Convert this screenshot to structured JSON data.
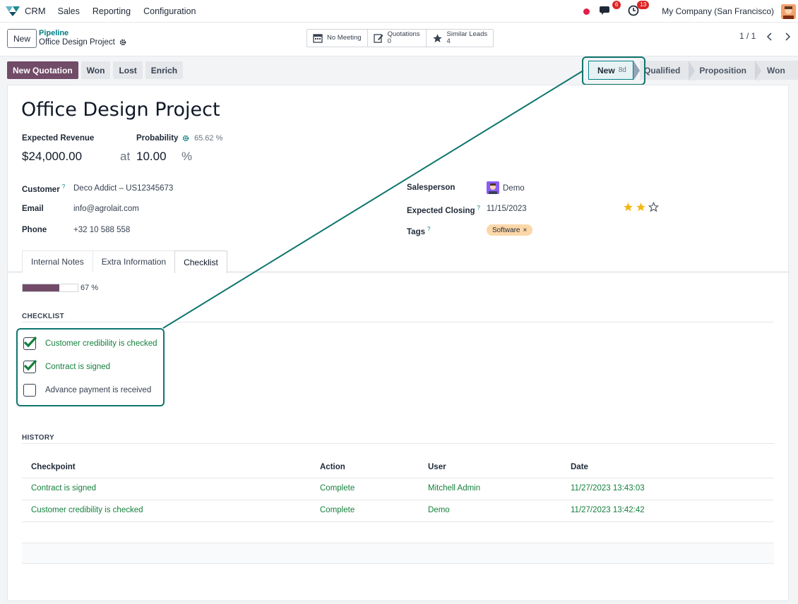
{
  "navbar": {
    "app_name": "CRM",
    "menu": [
      "Sales",
      "Reporting",
      "Configuration"
    ],
    "messages_count": "6",
    "activities_count": "13",
    "company": "My Company (San Francisco)"
  },
  "control": {
    "new_label": "New",
    "breadcrumb_parent": "Pipeline",
    "breadcrumb_current": "Office Design Project",
    "smart_buttons": [
      {
        "label": "No Meeting",
        "value": ""
      },
      {
        "label": "Quotations",
        "value": "0"
      },
      {
        "label": "Similar Leads",
        "value": "4"
      }
    ],
    "pager": "1 / 1"
  },
  "actions": {
    "new_quotation": "New Quotation",
    "won": "Won",
    "lost": "Lost",
    "enrich": "Enrich"
  },
  "statusbar": {
    "stages": [
      {
        "label": "New",
        "duration": "8d",
        "active": true
      },
      {
        "label": "Qualified"
      },
      {
        "label": "Proposition"
      },
      {
        "label": "Won"
      }
    ]
  },
  "form": {
    "title": "Office Design Project",
    "expected_revenue_label": "Expected Revenue",
    "probability_label": "Probability",
    "probability_auto": "65.62 %",
    "revenue": "$24,000.00",
    "at": "at",
    "probability_value": "10.00",
    "percent": "%",
    "customer_label": "Customer",
    "customer": "Deco Addict – US12345673",
    "email_label": "Email",
    "email": "info@agrolait.com",
    "phone_label": "Phone",
    "phone": "+32 10 588 558",
    "salesperson_label": "Salesperson",
    "salesperson": "Demo",
    "closing_label": "Expected Closing",
    "closing": "11/15/2023",
    "priority_stars": 2,
    "tags_label": "Tags",
    "tag": "Software",
    "tooltip_mark": "?"
  },
  "tabs": [
    "Internal Notes",
    "Extra Information",
    "Checklist"
  ],
  "checklist": {
    "progress_percent": 67,
    "progress_text": "67 %",
    "heading": "CHECKLIST",
    "items": [
      {
        "label": "Customer credibility is checked",
        "checked": true
      },
      {
        "label": "Contract is signed",
        "checked": true
      },
      {
        "label": "Advance payment is received",
        "checked": false
      }
    ]
  },
  "history": {
    "heading": "HISTORY",
    "columns": [
      "Checkpoint",
      "Action",
      "User",
      "Date"
    ],
    "rows": [
      [
        "Contract is signed",
        "Complete",
        "Mitchell Admin",
        "11/27/2023 13:43:03"
      ],
      [
        "Customer credibility is checked",
        "Complete",
        "Demo",
        "11/27/2023 13:42:42"
      ]
    ]
  },
  "colors": {
    "brand": "#714b67",
    "teal": "#017e84",
    "done_green": "#15803d",
    "highlight": "#0f766e",
    "tag_bg": "#fcd7a8",
    "star": "#f3b716"
  }
}
